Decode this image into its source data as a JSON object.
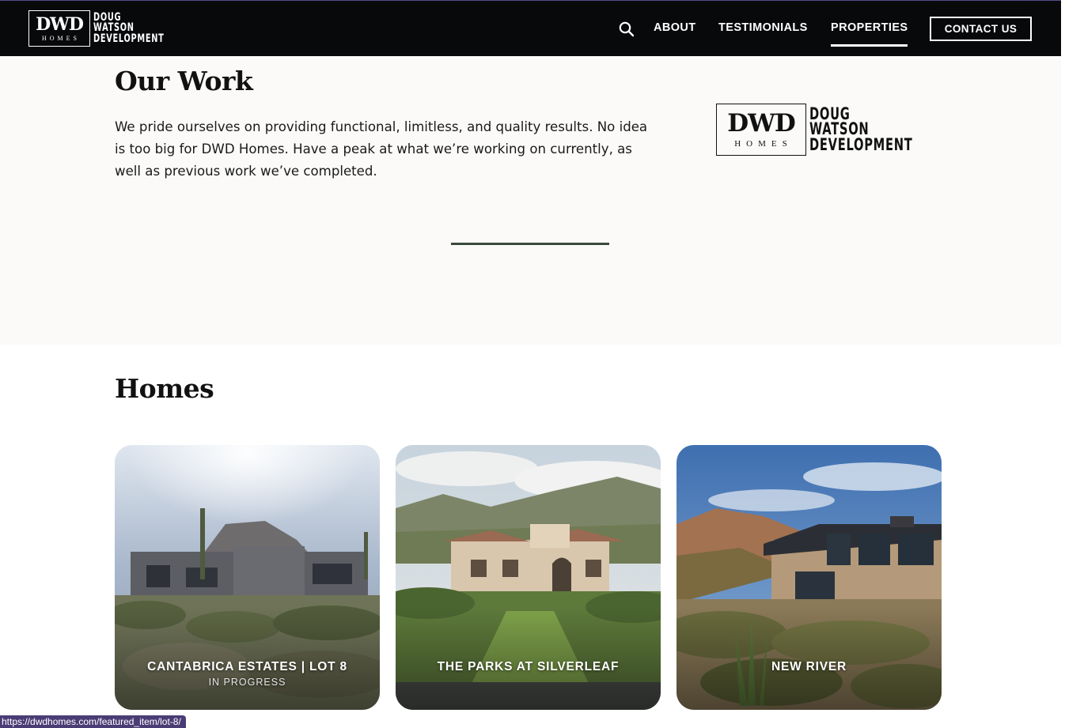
{
  "header": {
    "logo": {
      "mark": "DWD",
      "sub": "HOMES",
      "words": [
        "DOUG",
        "WATSON",
        "DEVELOPMENT"
      ]
    },
    "nav": [
      {
        "label": "ABOUT",
        "active": false
      },
      {
        "label": "TESTIMONIALS",
        "active": false
      },
      {
        "label": "PROPERTIES",
        "active": true
      }
    ],
    "contact_label": "CONTACT US",
    "search_icon": "search-icon"
  },
  "intro": {
    "title": "Our Work",
    "text": "We pride ourselves on providing functional, limitless, and quality results. No idea is too big for DWD Homes. Have a peak at what we’re working on currently, as well as previous work we’ve completed.",
    "logo": {
      "mark": "DWD",
      "sub": "HOMES",
      "words": [
        "DOUG",
        "WATSON",
        "DEVELOPMENT"
      ]
    }
  },
  "homes": {
    "title": "Homes",
    "cards": [
      {
        "title": "CANTABRICA ESTATES | LOT 8",
        "subtitle": "IN PROGRESS"
      },
      {
        "title": "THE PARKS AT SILVERLEAF",
        "subtitle": ""
      },
      {
        "title": "NEW RIVER",
        "subtitle": ""
      }
    ]
  },
  "status_bar": {
    "url": "https://dwdhomes.com/featured_item/lot-8/"
  },
  "colors": {
    "header_bg": "#07090b",
    "intro_bg": "#fbfaf8",
    "divider": "#3a4a3a",
    "status_bg": "#4a3d75"
  }
}
